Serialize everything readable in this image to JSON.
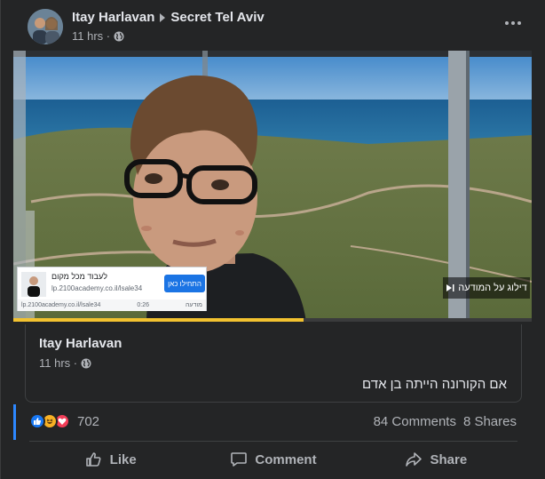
{
  "post": {
    "author": "Itay Harlavan",
    "group": "Secret Tel Aviv",
    "time": "11 hrs ·"
  },
  "video": {
    "progress_fraction": 0.56,
    "ad": {
      "title": "לעבוד מכל מקום",
      "url": "lp.2100academy.co.il/lsale34",
      "cta": "התחילו כאן",
      "footer_url": "lp.2100academy.co.il/lsale34",
      "footer_time": "0:26",
      "footer_label": "מודעה"
    },
    "skip_label": "דילוג על המודעה"
  },
  "shared_post": {
    "author": "Itay Harlavan",
    "time": "11 hrs ·",
    "text": "אם הקורונה הייתה בן אדם"
  },
  "engagement": {
    "reaction_count": "702",
    "comments": "84 Comments",
    "shares": "8 Shares"
  },
  "actions": {
    "like": "Like",
    "comment": "Comment",
    "share": "Share"
  },
  "colors": {
    "background": "#242526",
    "text": "#e4e6eb",
    "secondary": "#b0b3b8",
    "accent": "#2d88ff",
    "progress": "#f2c230"
  }
}
